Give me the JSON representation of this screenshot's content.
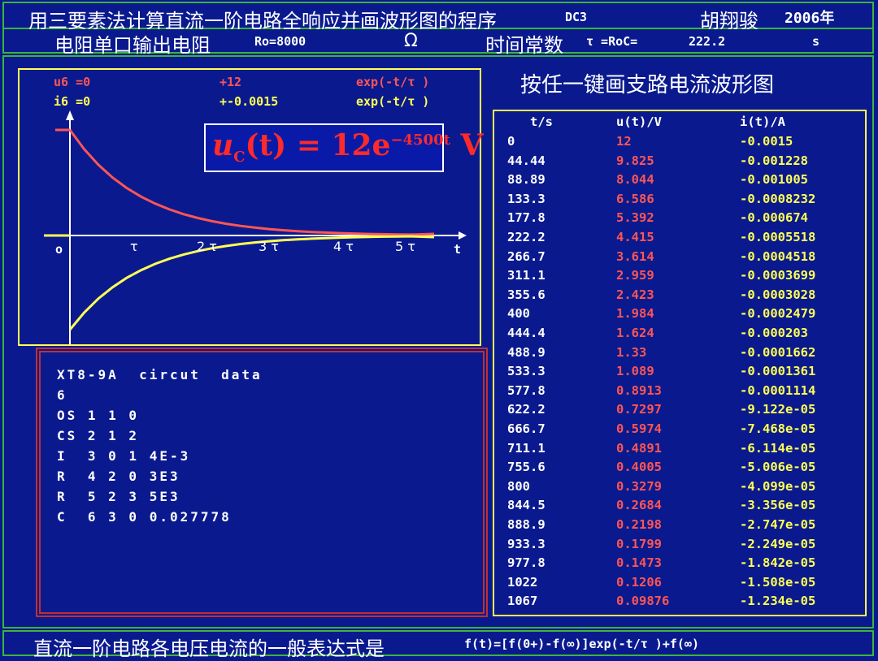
{
  "title": {
    "main": "用三要素法计算直流一阶电路全响应并画波形图的程序",
    "code": "DC3",
    "author": "胡翔骏",
    "year": "2006年"
  },
  "subtitle": {
    "label": "电阻单口输出电阻",
    "ro": "Ro=8000",
    "ohm": "Ω",
    "tau_label": "时间常数",
    "tau_expr": "τ =RoC=",
    "tau_value": "222.2",
    "tau_unit": "s"
  },
  "graph": {
    "u_init": "u6 =0",
    "u_coef": "+12",
    "u_exp": "exp(-t/τ )",
    "i_init": "i6 =0",
    "i_coef": "+-0.0015",
    "i_exp": "exp(-t/τ )",
    "formula_u": "u",
    "formula_sub": "C",
    "formula_mid": "(t) = 12e",
    "formula_sup": "−4500t",
    "formula_unit": " V",
    "axis_origin": "o",
    "axis_t": "t",
    "ticks": [
      "τ",
      "2 τ",
      "3 τ",
      "4 τ",
      "5 τ"
    ],
    "colors": {
      "voltage": "#ff5555",
      "current": "#ffff55",
      "axes": "#ffffff"
    }
  },
  "right_heading": "按任一键画支路电流波形图",
  "table": {
    "headers": [
      "t/s",
      "u(t)/V",
      "i(t)/A"
    ],
    "rows": [
      [
        "0",
        "12",
        "-0.0015"
      ],
      [
        "44.44",
        "9.825",
        "-0.001228"
      ],
      [
        "88.89",
        "8.044",
        "-0.001005"
      ],
      [
        "133.3",
        "6.586",
        "-0.0008232"
      ],
      [
        "177.8",
        "5.392",
        "-0.000674"
      ],
      [
        "222.2",
        "4.415",
        "-0.0005518"
      ],
      [
        "266.7",
        "3.614",
        "-0.0004518"
      ],
      [
        "311.1",
        "2.959",
        "-0.0003699"
      ],
      [
        "355.6",
        "2.423",
        "-0.0003028"
      ],
      [
        "400",
        "1.984",
        "-0.0002479"
      ],
      [
        "444.4",
        "1.624",
        "-0.000203"
      ],
      [
        "488.9",
        "1.33",
        "-0.0001662"
      ],
      [
        "533.3",
        "1.089",
        "-0.0001361"
      ],
      [
        "577.8",
        "0.8913",
        "-0.0001114"
      ],
      [
        "622.2",
        "0.7297",
        "-9.122e-05"
      ],
      [
        "666.7",
        "0.5974",
        "-7.468e-05"
      ],
      [
        "711.1",
        "0.4891",
        "-6.114e-05"
      ],
      [
        "755.6",
        "0.4005",
        "-5.006e-05"
      ],
      [
        "800",
        "0.3279",
        "-4.099e-05"
      ],
      [
        "844.5",
        "0.2684",
        "-3.356e-05"
      ],
      [
        "888.9",
        "0.2198",
        "-2.747e-05"
      ],
      [
        "933.3",
        "0.1799",
        "-2.249e-05"
      ],
      [
        "977.8",
        "0.1473",
        "-1.842e-05"
      ],
      [
        "1022",
        "0.1206",
        "-1.508e-05"
      ],
      [
        "1067",
        "0.09876",
        "-1.234e-05"
      ]
    ]
  },
  "netlist": {
    "lines": [
      "XT8-9A  circut  data",
      "6",
      "OS 1 1 0",
      "CS 2 1 2",
      "I  3 0 1 4E-3",
      "R  4 2 0 3E3",
      "R  5 2 3 5E3",
      "C  6 3 0 0.027778"
    ]
  },
  "footer": {
    "label": "直流一阶电路各电压电流的一般表达式是",
    "formula": "f(t)=[f(0+)-f(∞)]exp(-t/τ )+f(∞)"
  }
}
